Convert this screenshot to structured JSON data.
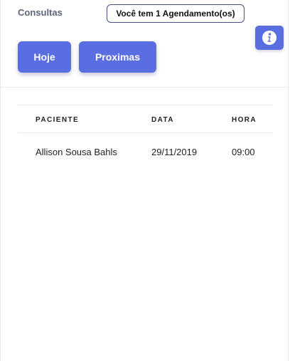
{
  "header": {
    "title": "Consultas",
    "appointment_badge": "Você tem 1 Agendamento(os)"
  },
  "actions": {
    "today_label": "Hoje",
    "upcoming_label": "Proximas",
    "info_icon": "info-icon"
  },
  "table": {
    "columns": [
      "PACIENTE",
      "DATA",
      "HORA"
    ],
    "rows": [
      [
        "Allison Sousa Bahls",
        "29/11/2019",
        "09:00"
      ]
    ]
  },
  "colors": {
    "accent": "#5b6ee1",
    "badge_border": "#46508a",
    "title_text": "#5b6478"
  }
}
